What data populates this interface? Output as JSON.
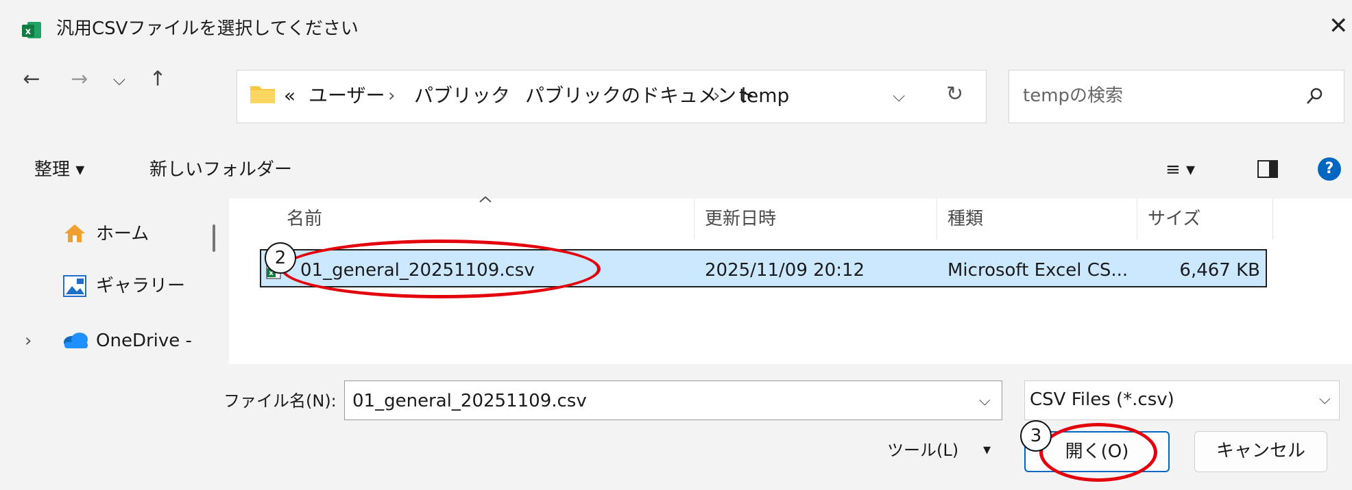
{
  "window": {
    "title": "汎用CSVファイルを選択してください",
    "close": "✕"
  },
  "nav": {
    "back": "←",
    "forward": "→",
    "recent": "⌵",
    "up": "↑"
  },
  "address": {
    "overflow": "«",
    "crumbs": [
      "ユーザー",
      "パブリック",
      "パブリックのドキュメント",
      "temp"
    ],
    "separator": "›",
    "dropdown": "⌵",
    "refresh": "↻"
  },
  "search": {
    "placeholder": "tempの検索"
  },
  "toolbar": {
    "organize": "整理 ▾",
    "new_folder": "新しいフォルダー",
    "view": "≡ ▾",
    "help": "?"
  },
  "sidebar": {
    "items": [
      {
        "label": "ホーム",
        "icon": "home-icon"
      },
      {
        "label": "ギャラリー",
        "icon": "gallery-icon"
      },
      {
        "label": "OneDrive -",
        "icon": "onedrive-icon",
        "expand": "›"
      }
    ]
  },
  "columns": [
    "名前",
    "更新日時",
    "種類",
    "サイズ"
  ],
  "files": [
    {
      "name": "01_general_20251109.csv",
      "modified": "2025/11/09 20:12",
      "type": "Microsoft Excel CS...",
      "size": "6,467 KB",
      "selected": true
    }
  ],
  "bottom": {
    "filename_label": "ファイル名(N):",
    "filename_value": "01_general_20251109.csv",
    "filetype": "CSV Files (*.csv)",
    "tools": "ツール(L)",
    "tools_arrow": "▾",
    "open": "開く(O)",
    "cancel": "キャンセル"
  },
  "annotations": {
    "step2": "2",
    "step3": "3",
    "color": "#e3000b"
  },
  "colors": {
    "accent": "#0067c0",
    "selection": "#cce8ff",
    "folder": "#f8c93f"
  }
}
